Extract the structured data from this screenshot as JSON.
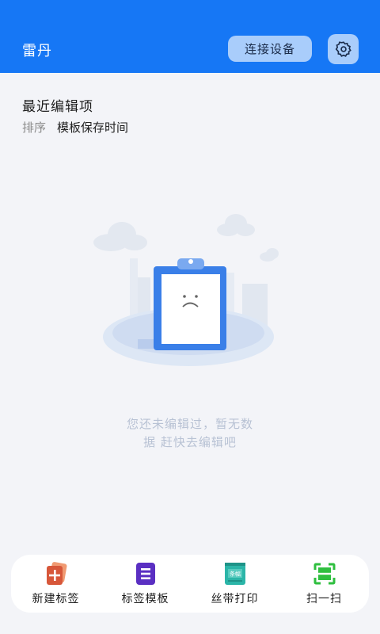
{
  "header": {
    "title": "雷丹",
    "connect_label": "连接设备",
    "settings_icon": "gear-icon"
  },
  "recent": {
    "title": "最近编辑项",
    "sort_label": "排序",
    "sort_value": "模板保存时间"
  },
  "empty_state": {
    "icon": "sad-clipboard-icon",
    "message_line1": "您还未编辑过，暂无数",
    "message_line2": "据 赶快去编辑吧"
  },
  "bottom_nav": {
    "items": [
      {
        "label": "新建标签",
        "icon": "new-label-icon",
        "color": "#e06a4a"
      },
      {
        "label": "标签模板",
        "icon": "template-list-icon",
        "color": "#6a3fd0"
      },
      {
        "label": "丝带打印",
        "icon": "ribbon-print-icon",
        "color": "#2bb5a8",
        "icon_text": "条幅"
      },
      {
        "label": "扫一扫",
        "icon": "scan-icon",
        "color": "#2fbf3f"
      }
    ]
  },
  "colors": {
    "brand": "#1677f5",
    "button_bg": "#a9cdfb",
    "page_bg": "#f3f4f8"
  }
}
